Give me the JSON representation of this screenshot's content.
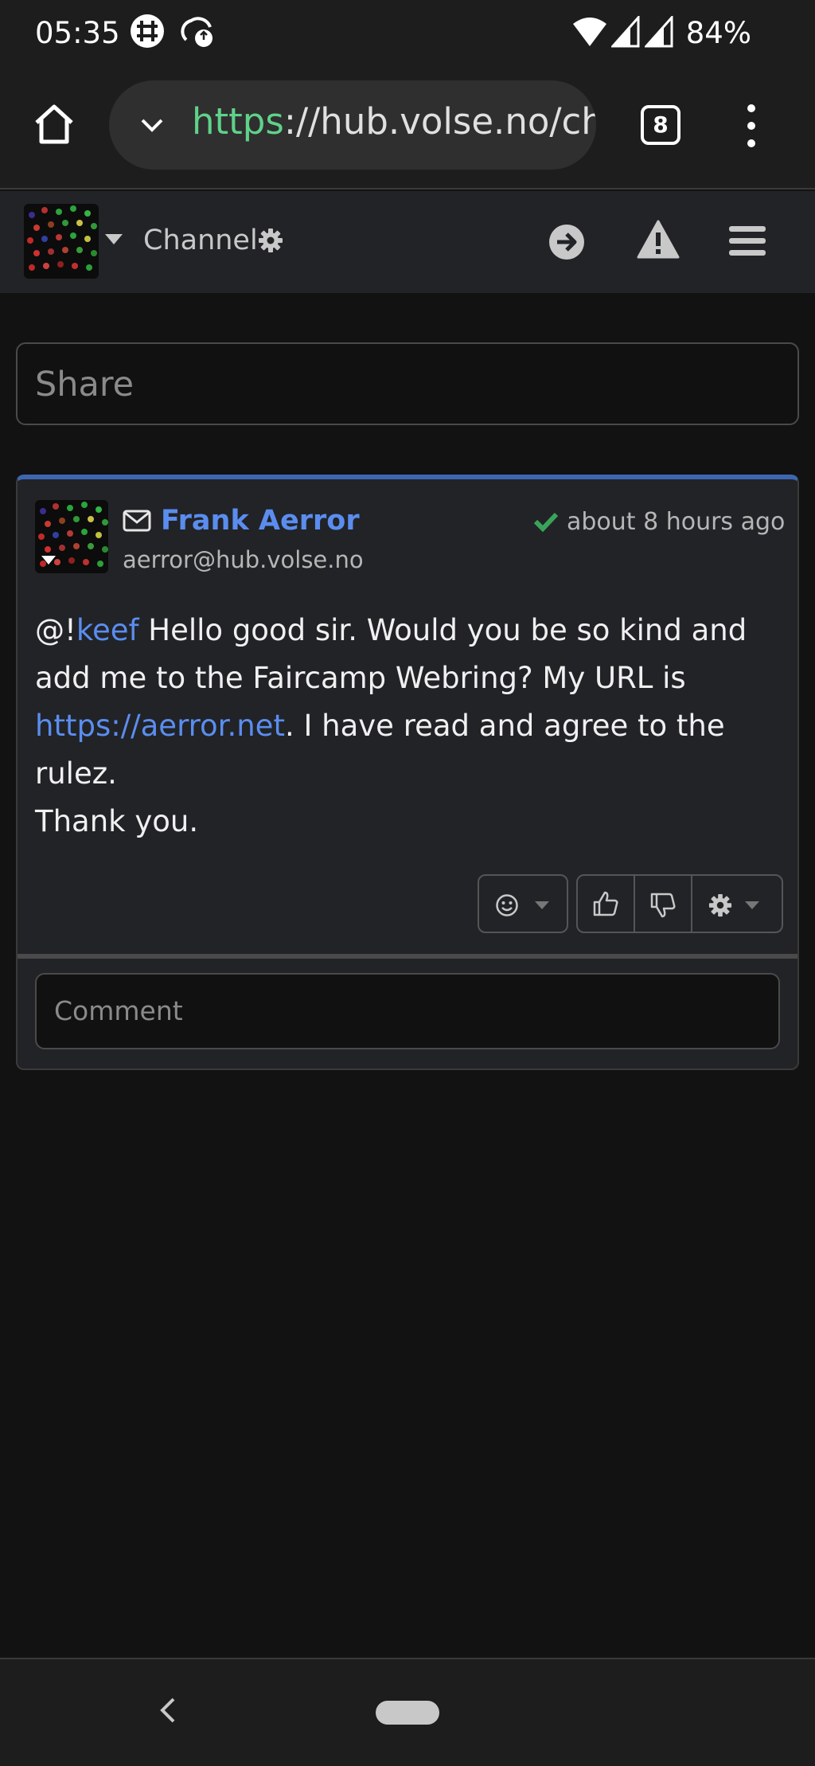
{
  "status_bar": {
    "time": "05:35",
    "battery": "84%",
    "icons": [
      "grid-app-icon",
      "sync-cloud-icon",
      "wifi-icon",
      "signal-icon",
      "signal-icon"
    ]
  },
  "browser": {
    "url_scheme": "https",
    "url_rest": "://hub.volse.no/ch",
    "tab_count": "8"
  },
  "navbar": {
    "channel_label": "Channel",
    "icons": [
      "gear-icon",
      "arrow-right-circle-icon",
      "warning-icon",
      "menu-icon"
    ]
  },
  "share": {
    "placeholder": "Share"
  },
  "post": {
    "author": "Frank Aerror",
    "address": "aerror@hub.volse.no",
    "time": "about 8 hours ago",
    "mention_prefix": "@!",
    "mention": "keef",
    "text_1": " Hello good sir. Would you be so kind and add me to the Faircamp Webring? My URL is ",
    "link": "https://aerror.net",
    "text_2": ". I have read and agree to the rulez.",
    "text_3": "Thank you.",
    "comment_placeholder": "Comment"
  },
  "colors": {
    "accent": "#5b8def",
    "url_scheme": "#5fd28a",
    "verified": "#3aa35a",
    "card_top": "#3e66b0"
  }
}
